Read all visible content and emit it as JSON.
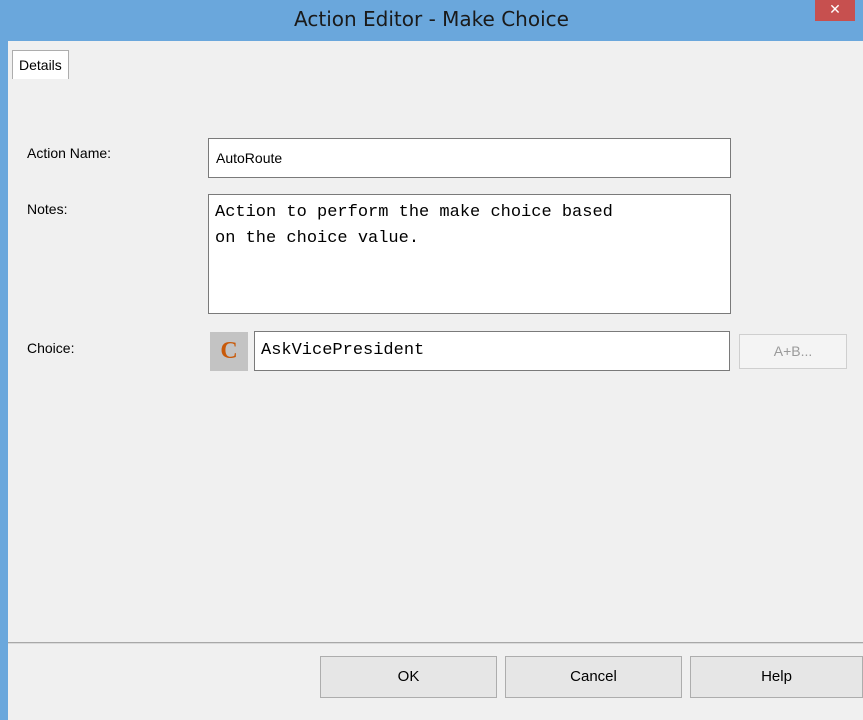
{
  "window": {
    "title": "Action Editor - Make Choice",
    "close_glyph": "✕"
  },
  "tabs": [
    {
      "label": "Details"
    }
  ],
  "form": {
    "action_name_label": "Action Name:",
    "action_name_value": "AutoRoute",
    "notes_label": "Notes:",
    "notes_value": "Action to perform the make choice based\non the choice value.",
    "choice_label": "Choice:",
    "choice_icon_glyph": "C",
    "choice_value": "AskVicePresident",
    "expression_button_label": "A+B..."
  },
  "buttons": {
    "ok": "OK",
    "cancel": "Cancel",
    "help": "Help"
  },
  "colors": {
    "title_bar": "#6aa7dc",
    "close_button": "#c7504f",
    "choice_icon": "#c85a0a"
  }
}
